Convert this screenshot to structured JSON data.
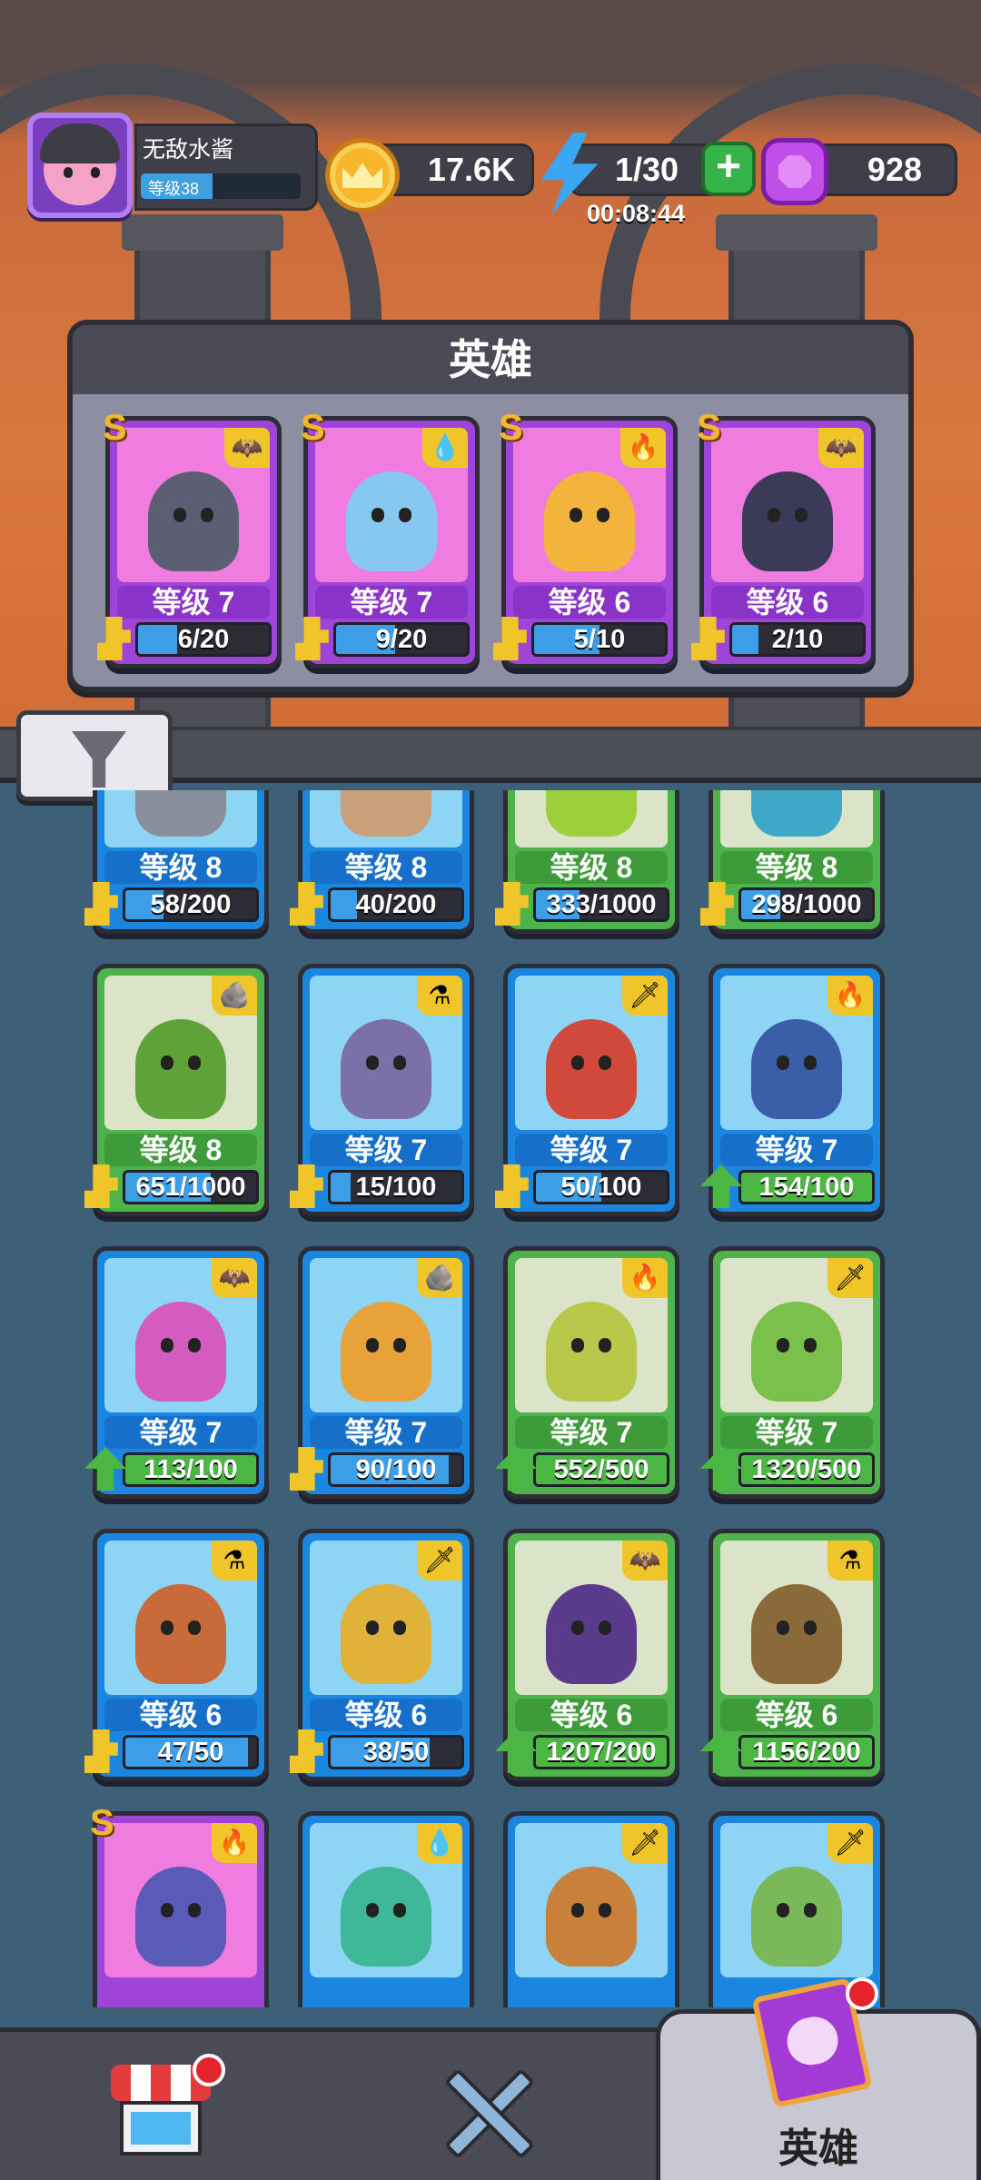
{
  "player": {
    "name": "无敌水酱",
    "level": "等级38"
  },
  "currency": {
    "gold": "17.6K",
    "energy": "1/30",
    "energy_timer": "00:08:44",
    "gems": "928"
  },
  "team": {
    "title": "英雄",
    "cards": [
      {
        "rank": "S",
        "level": "等级 7",
        "progress": "6/20",
        "fill": 0.3,
        "theme": "purple",
        "element_icon": "bat-icon",
        "mascot_color": "#5c5f73"
      },
      {
        "rank": "S",
        "level": "等级 7",
        "progress": "9/20",
        "fill": 0.45,
        "theme": "purple",
        "element_icon": "water-drop-icon",
        "mascot_color": "#86c8f0"
      },
      {
        "rank": "S",
        "level": "等级 6",
        "progress": "5/10",
        "fill": 0.5,
        "theme": "purple",
        "element_icon": "fire-icon",
        "mascot_color": "#f2b43a"
      },
      {
        "rank": "S",
        "level": "等级 6",
        "progress": "2/10",
        "fill": 0.2,
        "theme": "purple",
        "element_icon": "bat-icon",
        "mascot_color": "#3b3b58"
      }
    ]
  },
  "heroes": [
    {
      "level": "等级 8",
      "progress": "58/200",
      "fill": 0.29,
      "theme": "blue",
      "token": "piece",
      "element_icon": "",
      "mascot_color": "#8a8f9c"
    },
    {
      "level": "等级 8",
      "progress": "40/200",
      "fill": 0.2,
      "theme": "blue",
      "token": "piece",
      "element_icon": "",
      "mascot_color": "#c9a07a"
    },
    {
      "level": "等级 8",
      "progress": "333/1000",
      "fill": 0.33,
      "theme": "green",
      "token": "piece",
      "element_icon": "",
      "mascot_color": "#9ccf3a"
    },
    {
      "level": "等级 8",
      "progress": "298/1000",
      "fill": 0.3,
      "theme": "green",
      "token": "piece",
      "element_icon": "",
      "mascot_color": "#3fa8c8"
    },
    {
      "level": "等级 8",
      "progress": "651/1000",
      "fill": 0.65,
      "theme": "green",
      "token": "piece",
      "element_icon": "rock-icon",
      "mascot_color": "#5fa23a"
    },
    {
      "level": "等级 7",
      "progress": "15/100",
      "fill": 0.15,
      "theme": "blue",
      "token": "piece",
      "element_icon": "potion-icon",
      "mascot_color": "#7b70a8"
    },
    {
      "level": "等级 7",
      "progress": "50/100",
      "fill": 0.5,
      "theme": "blue",
      "token": "piece",
      "element_icon": "sword-icon",
      "mascot_color": "#d0493a"
    },
    {
      "level": "等级 7",
      "progress": "154/100",
      "fill": 1.0,
      "theme": "blue",
      "token": "up",
      "element_icon": "fire-icon",
      "mascot_color": "#3a5fa8"
    },
    {
      "level": "等级 7",
      "progress": "113/100",
      "fill": 1.0,
      "theme": "blue",
      "token": "up",
      "element_icon": "bat-icon",
      "mascot_color": "#d45cc0"
    },
    {
      "level": "等级 7",
      "progress": "90/100",
      "fill": 0.9,
      "theme": "blue",
      "token": "piece",
      "element_icon": "rock-icon",
      "mascot_color": "#e8a23a"
    },
    {
      "level": "等级 7",
      "progress": "552/500",
      "fill": 1.0,
      "theme": "green",
      "token": "up",
      "element_icon": "fire-icon",
      "mascot_color": "#b8c84a"
    },
    {
      "level": "等级 7",
      "progress": "1320/500",
      "fill": 1.0,
      "theme": "green",
      "token": "up",
      "element_icon": "sword-icon",
      "mascot_color": "#7ac04a"
    },
    {
      "level": "等级 6",
      "progress": "47/50",
      "fill": 0.94,
      "theme": "blue",
      "token": "piece",
      "element_icon": "potion-icon",
      "mascot_color": "#c86a3a"
    },
    {
      "level": "等级 6",
      "progress": "38/50",
      "fill": 0.76,
      "theme": "blue",
      "token": "piece",
      "element_icon": "sword-icon",
      "mascot_color": "#e0b23a"
    },
    {
      "level": "等级 6",
      "progress": "1207/200",
      "fill": 1.0,
      "theme": "green",
      "token": "up",
      "element_icon": "bat-icon",
      "mascot_color": "#5a3a8a"
    },
    {
      "level": "等级 6",
      "progress": "1156/200",
      "fill": 1.0,
      "theme": "green",
      "token": "up",
      "element_icon": "potion-icon",
      "mascot_color": "#8a6a3a"
    },
    {
      "rank": "S",
      "level": "",
      "progress": "",
      "fill": 0,
      "theme": "purple",
      "token": "",
      "element_icon": "fire-icon",
      "mascot_color": "#5a5ab8"
    },
    {
      "level": "",
      "progress": "",
      "fill": 0,
      "theme": "blue",
      "token": "",
      "element_icon": "water-drop-icon",
      "mascot_color": "#3fb89a"
    },
    {
      "level": "",
      "progress": "",
      "fill": 0,
      "theme": "blue",
      "token": "",
      "element_icon": "sword-icon",
      "mascot_color": "#c8803a"
    },
    {
      "level": "",
      "progress": "",
      "fill": 0,
      "theme": "blue",
      "token": "",
      "element_icon": "sword-icon",
      "mascot_color": "#7ab85a"
    }
  ],
  "nav": {
    "shop_badge": true,
    "battle_label": "",
    "heroes_label": "英雄",
    "heroes_badge": true
  },
  "colors": {
    "bar_fill": "#3d9ee8",
    "up_fill": "#4cb642",
    "tag_bg": "#f0c52a"
  }
}
